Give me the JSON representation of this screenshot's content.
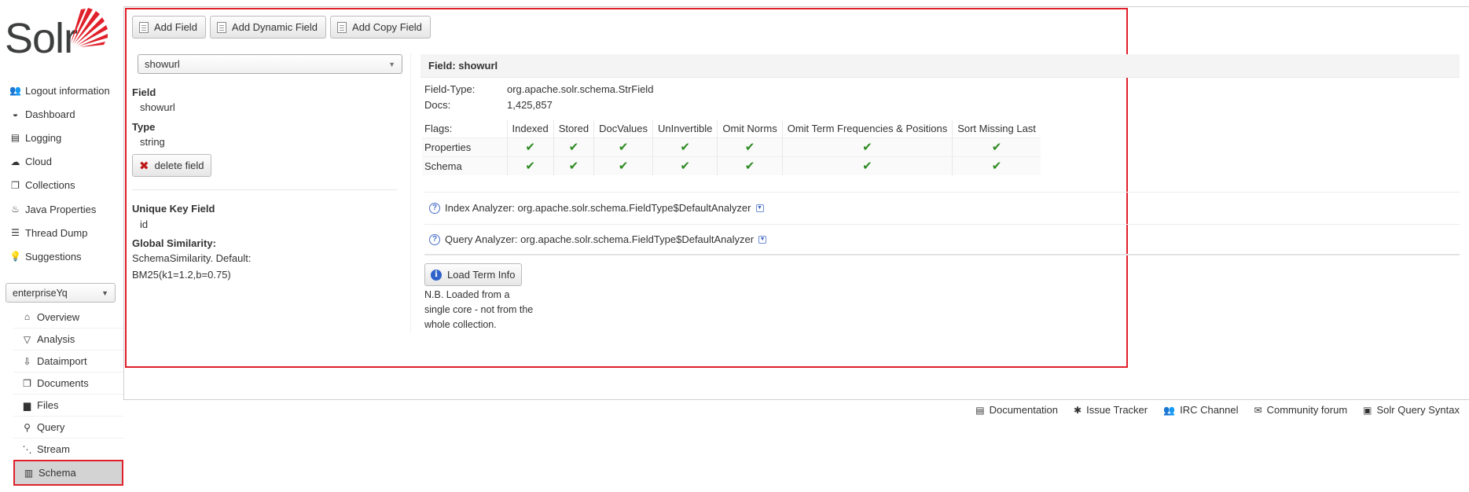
{
  "brand": {
    "name": "Solr",
    "accent": "#e0202a"
  },
  "main_menu": [
    {
      "label": "Logout information",
      "icon": "users-icon",
      "glyph": "👥"
    },
    {
      "label": "Dashboard",
      "icon": "dashboard-icon",
      "glyph": "◒"
    },
    {
      "label": "Logging",
      "icon": "logging-icon",
      "glyph": "▤"
    },
    {
      "label": "Cloud",
      "icon": "cloud-icon",
      "glyph": "☁"
    },
    {
      "label": "Collections",
      "icon": "collections-icon",
      "glyph": "❐"
    },
    {
      "label": "Java Properties",
      "icon": "java-icon",
      "glyph": "♨"
    },
    {
      "label": "Thread Dump",
      "icon": "thread-dump-icon",
      "glyph": "☰"
    },
    {
      "label": "Suggestions",
      "icon": "lightbulb-icon",
      "glyph": "💡"
    }
  ],
  "core_selector": {
    "value": "enterpriseYq"
  },
  "core_menu": [
    {
      "label": "Overview",
      "icon": "home-icon",
      "glyph": "⌂"
    },
    {
      "label": "Analysis",
      "icon": "funnel-icon",
      "glyph": "▽"
    },
    {
      "label": "Dataimport",
      "icon": "import-icon",
      "glyph": "⇩"
    },
    {
      "label": "Documents",
      "icon": "documents-icon",
      "glyph": "❐"
    },
    {
      "label": "Files",
      "icon": "folder-icon",
      "glyph": "▆"
    },
    {
      "label": "Query",
      "icon": "search-icon",
      "glyph": "⚲"
    },
    {
      "label": "Stream",
      "icon": "stream-icon",
      "glyph": "⋱"
    },
    {
      "label": "Schema",
      "icon": "schema-icon",
      "glyph": "▥"
    }
  ],
  "toolbar": {
    "add_field": "Add Field",
    "add_dynamic_field": "Add Dynamic Field",
    "add_copy_field": "Add Copy Field"
  },
  "field_selector": {
    "value": "showurl"
  },
  "left_panel": {
    "field_label": "Field",
    "field_value": "showurl",
    "type_label": "Type",
    "type_value": "string",
    "delete_button": "delete field",
    "unique_key_label": "Unique Key Field",
    "unique_key_value": "id",
    "similarity_label": "Global Similarity:",
    "similarity_line1": "SchemaSimilarity. Default:",
    "similarity_line2": "BM25(k1=1.2,b=0.75)"
  },
  "field_panel": {
    "header": "Field: showurl",
    "field_type_label": "Field-Type:",
    "field_type_value": "org.apache.solr.schema.StrField",
    "docs_label": "Docs:",
    "docs_value": "1,425,857",
    "flags_label": "Flags:",
    "flag_columns": [
      "Indexed",
      "Stored",
      "DocValues",
      "UnInvertible",
      "Omit Norms",
      "Omit Term Frequencies & Positions",
      "Sort Missing Last"
    ],
    "rows": [
      {
        "label": "Properties",
        "checks": [
          true,
          true,
          true,
          true,
          true,
          true,
          true
        ]
      },
      {
        "label": "Schema",
        "checks": [
          true,
          true,
          true,
          true,
          true,
          true,
          true
        ]
      }
    ],
    "check_glyph": "✔",
    "index_analyzer": "Index Analyzer: org.apache.solr.schema.FieldType$DefaultAnalyzer",
    "query_analyzer": "Query Analyzer: org.apache.solr.schema.FieldType$DefaultAnalyzer",
    "load_term_info": "Load Term Info",
    "note": "N.B. Loaded from a single core - not from the whole collection."
  },
  "footer": [
    {
      "label": "Documentation",
      "icon": "documentation-icon",
      "glyph": "▤"
    },
    {
      "label": "Issue Tracker",
      "icon": "bug-icon",
      "glyph": "✱"
    },
    {
      "label": "IRC Channel",
      "icon": "irc-icon",
      "glyph": "👥"
    },
    {
      "label": "Community forum",
      "icon": "mail-icon",
      "glyph": "✉"
    },
    {
      "label": "Solr Query Syntax",
      "icon": "query-syntax-icon",
      "glyph": "▣"
    }
  ]
}
